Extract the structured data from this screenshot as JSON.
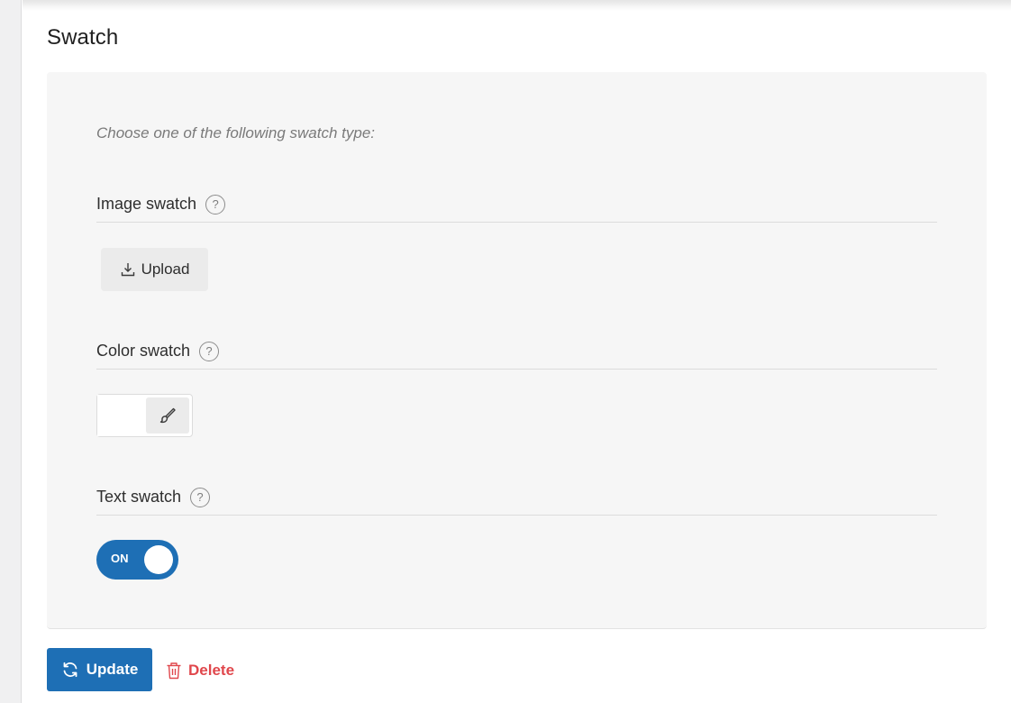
{
  "page": {
    "title": "Swatch"
  },
  "panel": {
    "intro": "Choose one of the following swatch type:"
  },
  "sections": {
    "image": {
      "label": "Image swatch",
      "help": "?",
      "icon": "help-icon"
    },
    "color": {
      "label": "Color swatch",
      "help": "?",
      "icon": "help-icon"
    },
    "text": {
      "label": "Text swatch",
      "help": "?",
      "icon": "help-icon"
    }
  },
  "image_swatch": {
    "upload_label": "Upload",
    "upload_icon": "download-icon"
  },
  "color_swatch": {
    "value": "#ffffff",
    "picker_icon": "brush-icon"
  },
  "text_swatch": {
    "toggle_label": "ON",
    "enabled": true
  },
  "actions": {
    "update_label": "Update",
    "update_icon": "refresh-icon",
    "delete_label": "Delete",
    "delete_icon": "trash-icon"
  },
  "colors": {
    "primary": "#1e6fb5",
    "danger": "#e0474c",
    "panel_bg": "#f6f6f6"
  }
}
